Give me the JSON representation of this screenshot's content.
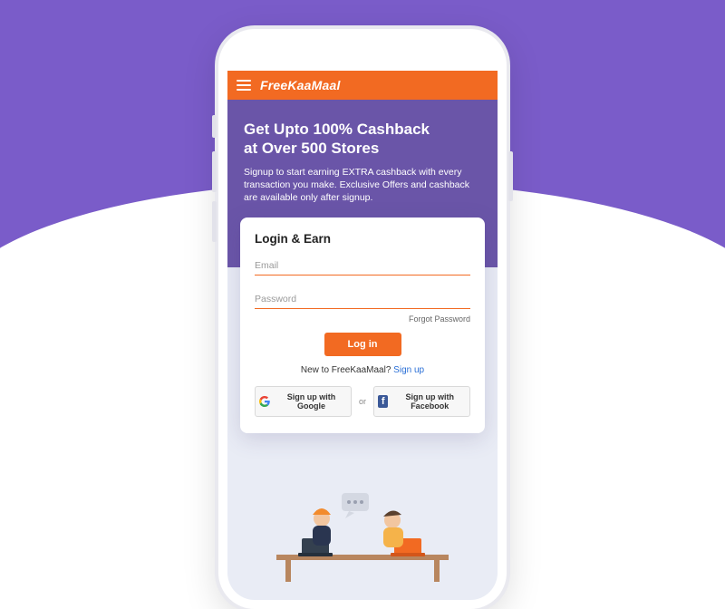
{
  "header": {
    "brand": "FreeKaaMaal"
  },
  "hero": {
    "title_line1": "Get Upto 100% Cashback",
    "title_line2": "at Over 500 Stores",
    "subtitle": "Signup to start earning EXTRA cashback with every transaction you make. Exclusive Offers and cashback are available only after signup."
  },
  "card": {
    "heading": "Login & Earn",
    "email_placeholder": "Email",
    "password_placeholder": "Password",
    "forgot": "Forgot Password",
    "login_label": "Log in",
    "new_to": "New to FreeKaaMaal? ",
    "signup_link": "Sign up",
    "google_label": "Sign up with Google",
    "or": "or",
    "facebook_label": "Sign up with Facebook"
  }
}
